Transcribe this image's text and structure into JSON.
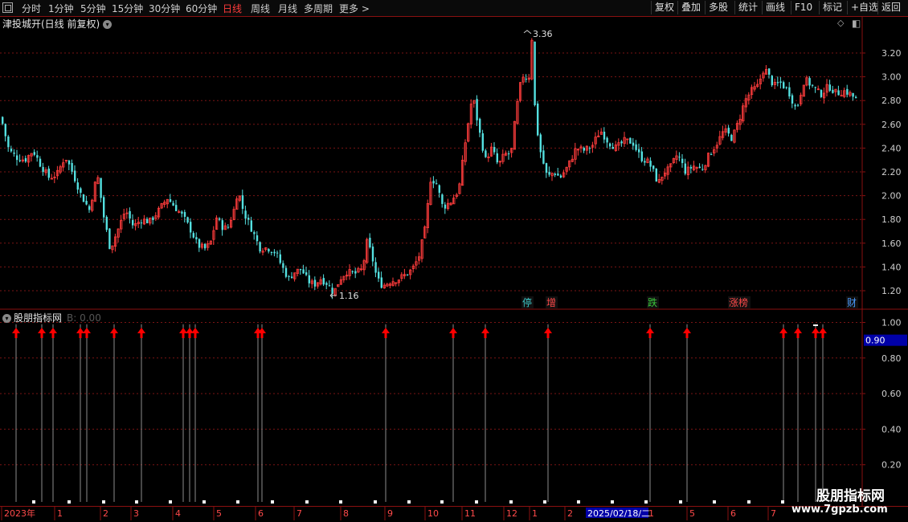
{
  "toolbar": {
    "periods": [
      "分时",
      "1分钟",
      "5分钟",
      "15分钟",
      "30分钟",
      "60分钟",
      "日线",
      "周线",
      "月线",
      "多周期",
      "更多 >"
    ],
    "active_period": "日线",
    "right_buttons": [
      "复权",
      "叠加",
      "多股",
      "统计",
      "画线",
      "F10",
      "标记",
      "+自选",
      "返回"
    ]
  },
  "main_chart": {
    "title": "津投城开(日线 前复权)",
    "y_ticks": [
      "3.20",
      "3.00",
      "2.80",
      "2.60",
      "2.40",
      "2.20",
      "2.00",
      "1.80",
      "1.60",
      "1.40",
      "1.20"
    ],
    "high_label": "3.36",
    "low_label": "1.16",
    "event_markers": [
      {
        "label": "停",
        "color": "#3cc8c8"
      },
      {
        "label": "增",
        "color": "#ff4a4a"
      },
      {
        "label": "跌",
        "color": "#3cc83c"
      },
      {
        "label": "涨榜",
        "color": "#ff4a4a"
      },
      {
        "label": "财",
        "color": "#4a9cff"
      }
    ]
  },
  "indicator": {
    "title": "股朋指标网",
    "value_text": "B: 0.00",
    "y_ticks": [
      "1.00",
      "0.80",
      "0.60",
      "0.40",
      "0.20"
    ],
    "current_value": "0.90"
  },
  "x_axis": {
    "labels": [
      "2023年",
      "1",
      "2",
      "3",
      "4",
      "5",
      "6",
      "7",
      "8",
      "9",
      "10",
      "11",
      "12",
      "1",
      "2",
      "1",
      "5",
      "6",
      "7"
    ],
    "highlight_date": "2025/02/18/二"
  },
  "watermark": {
    "main": "股朋指标网",
    "url": "www.7gpzb.com"
  },
  "colors": {
    "up": "#ff3c3c",
    "down": "#54e0e0",
    "grid": "#7a1414",
    "arrow": "#ff0000",
    "highlight_bg": "#0000a8"
  },
  "chart_data": {
    "type": "candlestick",
    "title": "津投城开(日线 前复权)",
    "ylim": [
      1.1,
      3.45
    ],
    "price_path": [
      [
        0,
        2.66
      ],
      [
        10,
        2.38
      ],
      [
        20,
        2.32
      ],
      [
        30,
        2.3
      ],
      [
        40,
        2.38
      ],
      [
        50,
        2.25
      ],
      [
        60,
        2.15
      ],
      [
        70,
        2.18
      ],
      [
        80,
        2.33
      ],
      [
        90,
        2.18
      ],
      [
        100,
        2.0
      ],
      [
        110,
        1.88
      ],
      [
        120,
        2.18
      ],
      [
        128,
        1.82
      ],
      [
        136,
        1.55
      ],
      [
        145,
        1.7
      ],
      [
        155,
        1.88
      ],
      [
        165,
        1.74
      ],
      [
        175,
        1.8
      ],
      [
        185,
        1.78
      ],
      [
        195,
        1.86
      ],
      [
        207,
        1.98
      ],
      [
        217,
        1.9
      ],
      [
        227,
        1.82
      ],
      [
        237,
        1.7
      ],
      [
        245,
        1.58
      ],
      [
        255,
        1.55
      ],
      [
        262,
        1.62
      ],
      [
        268,
        1.82
      ],
      [
        275,
        1.74
      ],
      [
        282,
        1.72
      ],
      [
        290,
        1.88
      ],
      [
        295,
        2.05
      ],
      [
        302,
        1.86
      ],
      [
        312,
        1.72
      ],
      [
        322,
        1.56
      ],
      [
        332,
        1.56
      ],
      [
        342,
        1.52
      ],
      [
        350,
        1.4
      ],
      [
        358,
        1.3
      ],
      [
        366,
        1.36
      ],
      [
        374,
        1.38
      ],
      [
        382,
        1.28
      ],
      [
        390,
        1.25
      ],
      [
        398,
        1.3
      ],
      [
        406,
        1.26
      ],
      [
        414,
        1.18
      ],
      [
        422,
        1.3
      ],
      [
        430,
        1.36
      ],
      [
        440,
        1.34
      ],
      [
        450,
        1.38
      ],
      [
        456,
        1.62
      ],
      [
        462,
        1.48
      ],
      [
        468,
        1.3
      ],
      [
        475,
        1.24
      ],
      [
        485,
        1.28
      ],
      [
        495,
        1.3
      ],
      [
        505,
        1.34
      ],
      [
        512,
        1.38
      ],
      [
        520,
        1.48
      ],
      [
        528,
        1.72
      ],
      [
        535,
        2.15
      ],
      [
        542,
        2.1
      ],
      [
        550,
        1.9
      ],
      [
        560,
        1.95
      ],
      [
        570,
        2.05
      ],
      [
        578,
        2.45
      ],
      [
        587,
        2.85
      ],
      [
        595,
        2.55
      ],
      [
        603,
        2.3
      ],
      [
        611,
        2.4
      ],
      [
        619,
        2.25
      ],
      [
        627,
        2.35
      ],
      [
        635,
        2.35
      ],
      [
        641,
        2.7
      ],
      [
        647,
        2.95
      ],
      [
        652,
        3.05
      ],
      [
        656,
        2.9
      ],
      [
        661,
        3.34
      ],
      [
        665,
        2.65
      ],
      [
        672,
        2.35
      ],
      [
        680,
        2.15
      ],
      [
        688,
        2.2
      ],
      [
        696,
        2.15
      ],
      [
        706,
        2.25
      ],
      [
        716,
        2.4
      ],
      [
        726,
        2.38
      ],
      [
        736,
        2.42
      ],
      [
        746,
        2.55
      ],
      [
        756,
        2.45
      ],
      [
        766,
        2.4
      ],
      [
        776,
        2.46
      ],
      [
        786,
        2.45
      ],
      [
        796,
        2.32
      ],
      [
        806,
        2.28
      ],
      [
        812,
        2.2
      ],
      [
        818,
        2.1
      ],
      [
        825,
        2.2
      ],
      [
        832,
        2.22
      ],
      [
        842,
        2.35
      ],
      [
        852,
        2.2
      ],
      [
        862,
        2.25
      ],
      [
        872,
        2.22
      ],
      [
        882,
        2.35
      ],
      [
        892,
        2.45
      ],
      [
        900,
        2.55
      ],
      [
        910,
        2.48
      ],
      [
        918,
        2.62
      ],
      [
        926,
        2.8
      ],
      [
        934,
        2.88
      ],
      [
        942,
        2.92
      ],
      [
        950,
        3.08
      ],
      [
        956,
        3.0
      ],
      [
        962,
        2.92
      ],
      [
        970,
        2.95
      ],
      [
        980,
        2.88
      ],
      [
        990,
        2.72
      ],
      [
        1000,
        2.98
      ],
      [
        1010,
        2.92
      ],
      [
        1020,
        2.85
      ],
      [
        1030,
        2.92
      ],
      [
        1040,
        2.86
      ],
      [
        1050,
        2.88
      ],
      [
        1058,
        2.85
      ],
      [
        1065,
        2.8
      ]
    ],
    "signal_arrow_x": [
      20,
      52,
      66,
      100,
      108,
      142,
      176,
      228,
      236,
      243,
      321,
      326,
      480,
      564,
      604,
      682,
      809,
      855,
      975,
      993,
      1015,
      1024
    ],
    "signal_bottom_marks_x": [
      42,
      86,
      129,
      170,
      212,
      254,
      296,
      339,
      382,
      424,
      467,
      509,
      550,
      593,
      636,
      678,
      720,
      762,
      804,
      847,
      889,
      932,
      974
    ]
  }
}
